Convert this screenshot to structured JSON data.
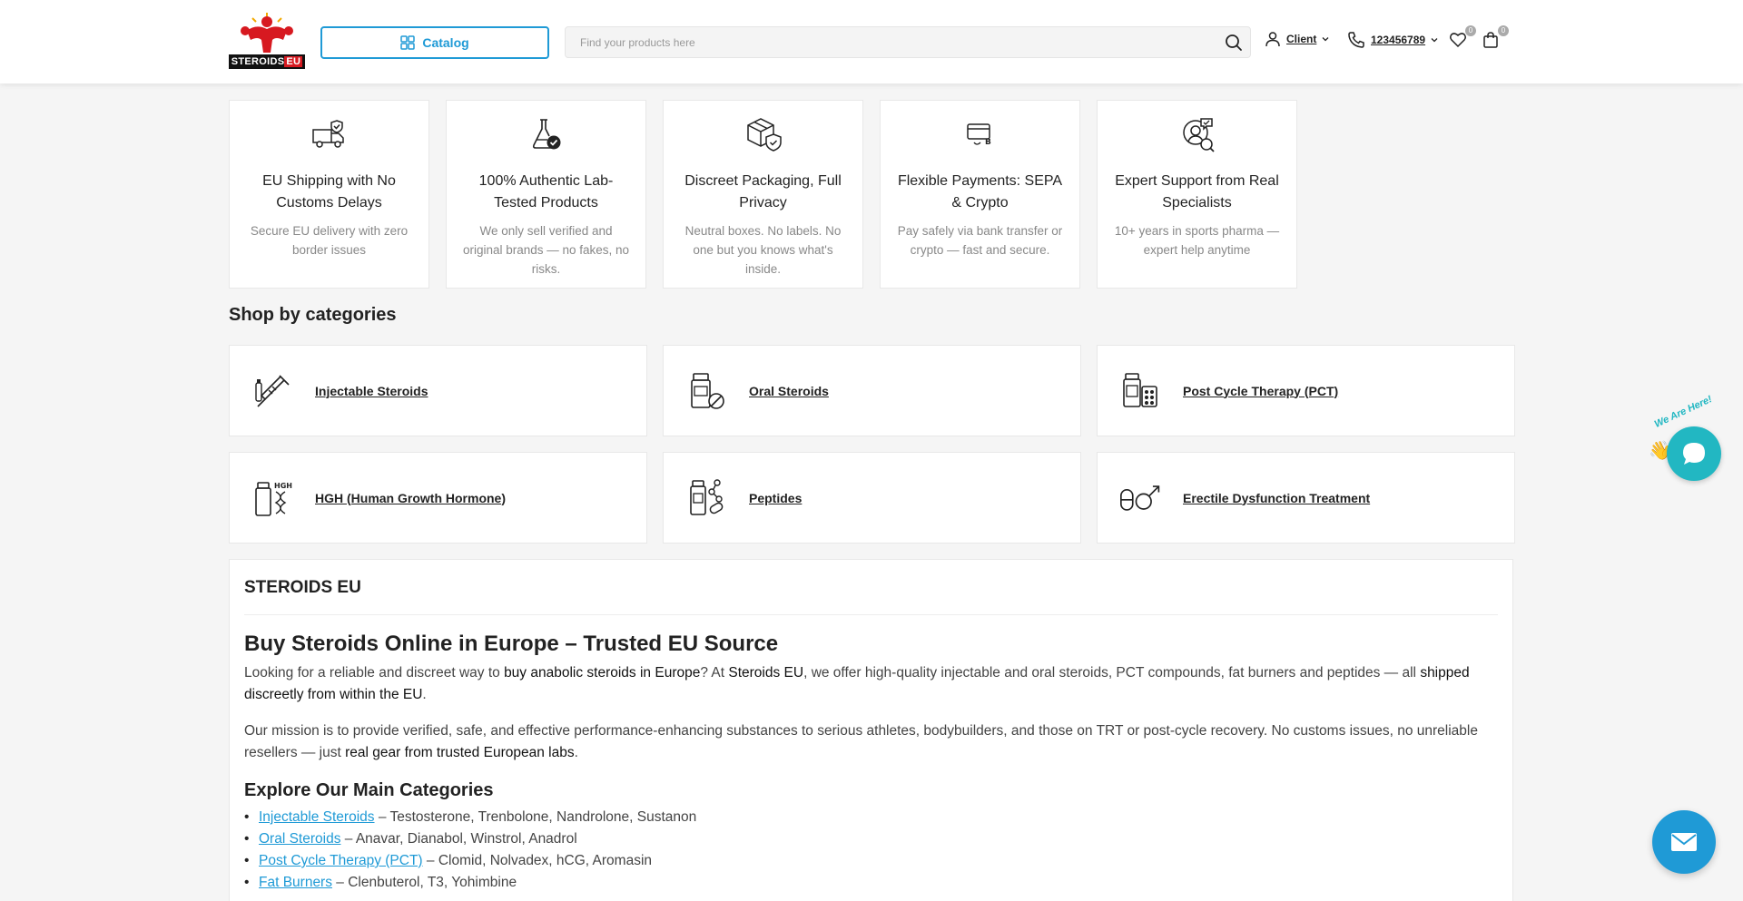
{
  "header": {
    "logo_text": "STEROIDS",
    "logo_suffix": "EU",
    "catalog_label": "Catalog",
    "search_placeholder": "Find your products here",
    "client_label": "Client",
    "phone": "123456789",
    "wishlist_count": "0",
    "cart_count": "0"
  },
  "features": [
    {
      "icon": "truck-shield-icon",
      "title": "EU Shipping with No Customs Delays",
      "desc": "Secure EU delivery with zero border issues"
    },
    {
      "icon": "lab-flask-icon",
      "title": "100% Authentic Lab-Tested Products",
      "desc": "We only sell verified and original brands — no fakes, no risks."
    },
    {
      "icon": "package-shield-icon",
      "title": "Discreet Packaging, Full Privacy",
      "desc": "Neutral boxes. No labels. No one but you knows what's inside."
    },
    {
      "icon": "payment-card-icon",
      "title": "Flexible Payments: SEPA & Crypto",
      "desc": "Pay safely via bank transfer or crypto — fast and secure."
    },
    {
      "icon": "support-chat-icon",
      "title": "Expert Support from Real Specialists",
      "desc": "10+ years in sports pharma — expert help anytime"
    }
  ],
  "categories_title": "Shop by categories",
  "categories": [
    {
      "icon": "syringe-icon",
      "label": "Injectable Steroids"
    },
    {
      "icon": "pill-bottle-icon",
      "label": "Oral Steroids"
    },
    {
      "icon": "pct-bottle-icon",
      "label": "Post Cycle Therapy (PCT)"
    },
    {
      "icon": "hgh-vial-icon",
      "label": "HGH (Human Growth Hormone)"
    },
    {
      "icon": "peptide-vial-icon",
      "label": "Peptides"
    },
    {
      "icon": "male-pill-icon",
      "label": "Erectile Dysfunction Treatment"
    }
  ],
  "content": {
    "brand": "STEROIDS EU",
    "h1": "Buy Steroids Online in Europe – Trusted EU Source",
    "p1": {
      "a": "Looking for a reliable and discreet way to ",
      "b": "buy anabolic steroids in Europe",
      "c": "? At ",
      "d": "Steroids EU",
      "e": ", we offer high-quality injectable and oral steroids, PCT compounds, fat burners and peptides — all ",
      "f": "shipped discreetly from within the EU",
      "g": "."
    },
    "p2": {
      "a": "Our mission is to provide verified, safe, and effective performance-enhancing substances to serious athletes, bodybuilders, and those on TRT or post-cycle recovery. No customs issues, no unreliable resellers — just ",
      "b": "real gear from trusted European labs",
      "c": "."
    },
    "h2": "Explore Our Main Categories",
    "list": [
      {
        "link": "Injectable Steroids",
        "rest": " – Testosterone, Trenbolone, Nandrolone, Sustanon"
      },
      {
        "link": "Oral Steroids",
        "rest": " – Anavar, Dianabol, Winstrol, Anadrol"
      },
      {
        "link": "Post Cycle Therapy (PCT)",
        "rest": " – Clomid, Nolvadex, hCG, Aromasin"
      },
      {
        "link": "Fat Burners",
        "rest": " – Clenbuterol, T3, Yohimbine"
      }
    ]
  },
  "chat": {
    "tagline": "We Are Here!"
  },
  "colors": {
    "accent": "#1f9ad6",
    "chat": "#22b7c2",
    "logo_red": "#d71920"
  }
}
